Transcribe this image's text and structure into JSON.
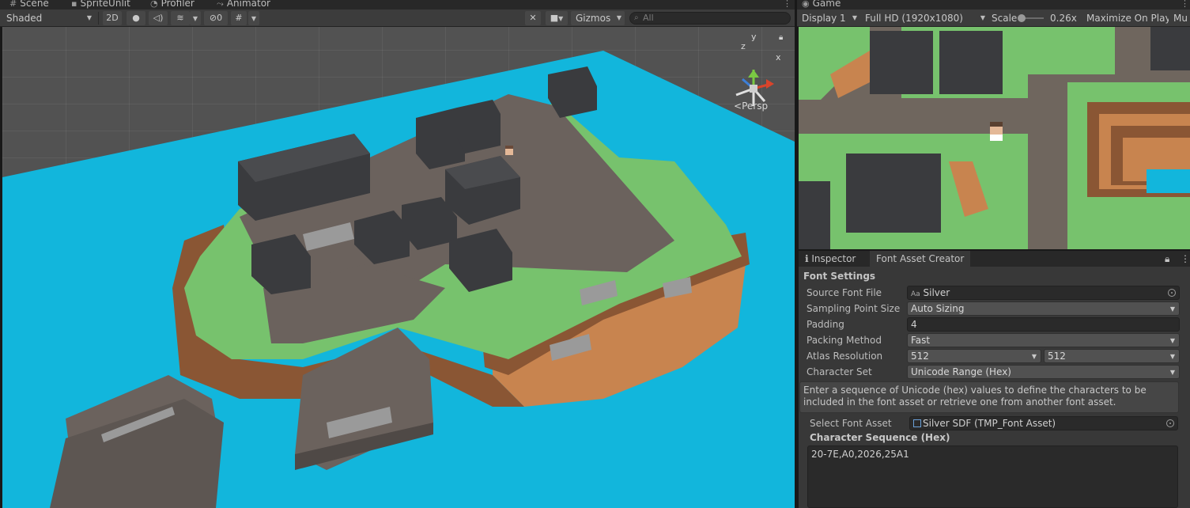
{
  "scene_tabs": {
    "scene": "Scene",
    "sprite_unlit": "SpriteUnlit",
    "profiler": "Profiler",
    "animator": "Animator"
  },
  "game_tab": "Game",
  "scene_toolbar": {
    "shading_mode": "Shaded",
    "mode_2d": "2D",
    "hidden_count": "0",
    "gizmos": "Gizmos",
    "search_placeholder": "All"
  },
  "scene_view": {
    "projection": "Persp",
    "axis_x": "x",
    "axis_y": "y",
    "axis_z": "z"
  },
  "game_toolbar": {
    "display": "Display 1",
    "resolution": "Full HD (1920x1080)",
    "scale_label": "Scale",
    "scale_value": "0.26x",
    "scale_fraction": 0.0,
    "maximize": "Maximize On Play",
    "mute": "Mu"
  },
  "inspector": {
    "tabs": [
      "Inspector",
      "Font Asset Creator"
    ],
    "section_title": "Font Settings",
    "source_font_label": "Source Font File",
    "source_font_value": "Silver",
    "source_font_icon": "Aa",
    "sampling_label": "Sampling Point Size",
    "sampling_value": "Auto Sizing",
    "padding_label": "Padding",
    "padding_value": "4",
    "packing_label": "Packing Method",
    "packing_value": "Fast",
    "atlas_label": "Atlas Resolution",
    "atlas_w": "512",
    "atlas_h": "512",
    "charset_label": "Character Set",
    "charset_value": "Unicode Range (Hex)",
    "help_text": "Enter a sequence of Unicode (hex) values to define the characters to be included in the font asset or retrieve one from another font asset.",
    "select_font_label": "Select Font Asset",
    "select_font_value": "Silver SDF (TMP_Font Asset)",
    "char_seq_label": "Character Sequence (Hex)",
    "char_seq_value": "20-7E,A0,2026,25A1"
  },
  "colors": {
    "water": "#12b6dc",
    "grass": "#77c26d",
    "dirt": "#c8844f",
    "cliff": "#8a5634",
    "road": "#6b625d",
    "block": "#3a3b3e"
  }
}
